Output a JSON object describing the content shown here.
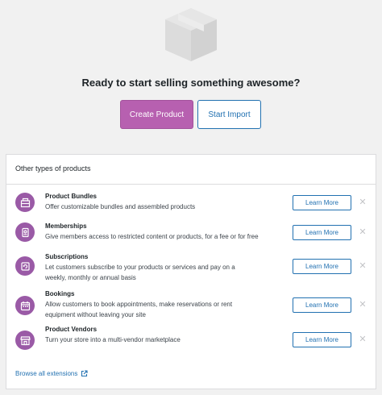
{
  "hero": {
    "title": "Ready to start selling something awesome?",
    "create_button": "Create Product",
    "import_button": "Start Import",
    "icon": "product-box-icon"
  },
  "panel": {
    "header": "Other types of products",
    "items": [
      {
        "icon": "bundle-icon",
        "title": "Product Bundles",
        "desc": "Offer customizable bundles and assembled products",
        "button": "Learn More",
        "dismiss": "✕"
      },
      {
        "icon": "membership-badge-icon",
        "title": "Memberships",
        "desc": "Give members access to restricted content or products, for a fee or for free",
        "button": "Learn More",
        "dismiss": "✕"
      },
      {
        "icon": "subscription-icon",
        "title": "Subscriptions",
        "desc": "Let customers subscribe to your products or services and pay on a weekly, monthly or annual basis",
        "button": "Learn More",
        "dismiss": "✕"
      },
      {
        "icon": "calendar-icon",
        "title": "Bookings",
        "desc": "Allow customers to book appointments, make reservations or rent equipment without leaving your site",
        "button": "Learn More",
        "dismiss": "✕"
      },
      {
        "icon": "storefront-icon",
        "title": "Product Vendors",
        "desc": "Turn your store into a multi-vendor marketplace",
        "button": "Learn More",
        "dismiss": "✕"
      }
    ],
    "browse_link": "Browse all extensions",
    "browse_icon": "external-link-icon"
  },
  "colors": {
    "primary": "#b760b0",
    "icon_bg": "#9a5aa6",
    "link": "#2271b1",
    "background": "#f1f1f1"
  }
}
